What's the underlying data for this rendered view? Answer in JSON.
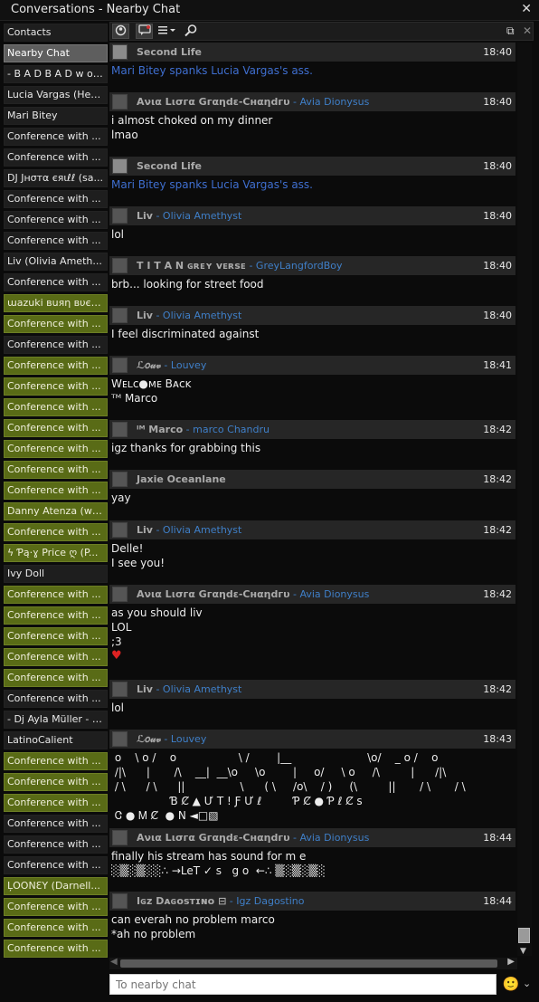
{
  "window": {
    "title": "Conversations - Nearby Chat",
    "close_glyph": "✕"
  },
  "sidebar": {
    "items": [
      {
        "label": "Contacts",
        "state": "plain"
      },
      {
        "label": "Nearby Chat",
        "state": "active"
      },
      {
        "label": "- B A D  B A D  w o l...",
        "state": "plain"
      },
      {
        "label": "Lucia Vargas (Her...",
        "state": "plain"
      },
      {
        "label": "Mari Bitey",
        "state": "plain"
      },
      {
        "label": "Conference with ...",
        "state": "plain"
      },
      {
        "label": "Conference with ...",
        "state": "plain"
      },
      {
        "label": "DJ Jнσтα єяιℓℓ (sa...",
        "state": "plain"
      },
      {
        "label": "Conference with ...",
        "state": "plain"
      },
      {
        "label": "Conference with ...",
        "state": "plain"
      },
      {
        "label": "Conference with ...",
        "state": "plain"
      },
      {
        "label": "Liv (Olivia Ameth...",
        "state": "plain"
      },
      {
        "label": "Conference with ...",
        "state": "plain"
      },
      {
        "label": "ɯazuki вuяη вυєη...",
        "state": "flash"
      },
      {
        "label": "Conference with ...",
        "state": "flash"
      },
      {
        "label": "Conference with ...",
        "state": "plain"
      },
      {
        "label": "Conference with ...",
        "state": "flash"
      },
      {
        "label": "Conference with ...",
        "state": "flash"
      },
      {
        "label": "Conference with ...",
        "state": "flash"
      },
      {
        "label": "Conference with ...",
        "state": "flash"
      },
      {
        "label": "Conference with ...",
        "state": "flash"
      },
      {
        "label": "Conference with ...",
        "state": "flash"
      },
      {
        "label": "Conference with ...",
        "state": "flash"
      },
      {
        "label": "Danny Atenza (wa...",
        "state": "flash"
      },
      {
        "label": "Conference with ...",
        "state": "flash"
      },
      {
        "label": "ϟ Ƥą·ɣ Price ღ (P...",
        "state": "flash"
      },
      {
        "label": "Ivy Doll",
        "state": "plain"
      },
      {
        "label": "Conference with ...",
        "state": "flash"
      },
      {
        "label": "Conference with ...",
        "state": "flash"
      },
      {
        "label": "Conference with ...",
        "state": "flash"
      },
      {
        "label": "Conference with ...",
        "state": "flash"
      },
      {
        "label": "Conference with ...",
        "state": "flash"
      },
      {
        "label": "Conference with ...",
        "state": "plain"
      },
      {
        "label": "- Dj Ayla Müller - (...",
        "state": "plain"
      },
      {
        "label": "LatinoCalient",
        "state": "plain"
      },
      {
        "label": "Conference with ...",
        "state": "flash"
      },
      {
        "label": "Conference with ...",
        "state": "flash"
      },
      {
        "label": "Conference with ...",
        "state": "flash"
      },
      {
        "label": "Conference with ...",
        "state": "plain"
      },
      {
        "label": "Conference with ...",
        "state": "plain"
      },
      {
        "label": "Conference with ...",
        "state": "plain"
      },
      {
        "label": "ĻOONƐΥ (Darnell...",
        "state": "flash"
      },
      {
        "label": "Conference with ...",
        "state": "flash"
      },
      {
        "label": "Conference with ...",
        "state": "flash"
      },
      {
        "label": "Conference with ...",
        "state": "flash"
      }
    ]
  },
  "toolbar": {
    "icons": [
      "people-icon",
      "chat-bubble-icon",
      "list-menu-icon",
      "search-icon"
    ],
    "undock_glyph": "⧉",
    "close_glyph": "✕"
  },
  "messages": [
    {
      "avatar": "system",
      "display": "Second Life",
      "user": "",
      "time": "18:40",
      "system": true,
      "lines": [
        "Mari Bitey spanks Lucia Vargas's ass."
      ]
    },
    {
      "avatar": "user",
      "display": "Aνια Lισгα Gгαηdε-Cнαηdгυ",
      "user": "Avia Dionysus",
      "time": "18:40",
      "lines": [
        "i almost choked on my dinner",
        "lmao"
      ]
    },
    {
      "avatar": "system",
      "display": "Second Life",
      "user": "",
      "time": "18:40",
      "system": true,
      "lines": [
        "Mari Bitey spanks Lucia Vargas's ass."
      ]
    },
    {
      "avatar": "user",
      "display": "Liv",
      "user": "Olivia Amethyst",
      "time": "18:40",
      "lines": [
        "lol"
      ]
    },
    {
      "avatar": "user",
      "display": "T I T A N  ɢʀᴇʏ ᴠᴇʀsᴇ",
      "user": "GreyLangfordBoy",
      "time": "18:40",
      "lines": [
        "brb... looking for street food"
      ]
    },
    {
      "avatar": "user",
      "display": "Liv",
      "user": "Olivia Amethyst",
      "time": "18:40",
      "lines": [
        "I feel discriminated against"
      ]
    },
    {
      "avatar": "user",
      "display": "ℒ𝑜𝓊𝓋",
      "user": "Louvey",
      "time": "18:41",
      "lines": [
        "Wᴇʟᴄ●ᴍᴇ Bᴀᴄᴋ",
        "ᵀᴹ Marco"
      ]
    },
    {
      "avatar": "user",
      "display": "ᴵᴹ Marco",
      "user": "marco Chandru",
      "time": "18:42",
      "lines": [
        "igz thanks for grabbing this"
      ]
    },
    {
      "avatar": "user",
      "display": "Jaxie Oceanlane",
      "user": "",
      "time": "18:42",
      "lines": [
        "yay"
      ]
    },
    {
      "avatar": "user",
      "display": "Liv",
      "user": "Olivia Amethyst",
      "time": "18:42",
      "lines": [
        "Delle!",
        "I see you!"
      ]
    },
    {
      "avatar": "user",
      "display": "Aνια Lισгα Gгαηdε-Cнαηdгυ",
      "user": "Avia Dionysus",
      "time": "18:42",
      "lines": [
        "as you should liv",
        "LOL",
        ";3",
        "♥"
      ]
    },
    {
      "avatar": "user",
      "display": "Liv",
      "user": "Olivia Amethyst",
      "time": "18:42",
      "lines": [
        "lol"
      ]
    },
    {
      "avatar": "user",
      "display": "ℒ𝑜𝓊𝓋",
      "user": "Louvey",
      "time": "18:43",
      "lines": [
        " o    \\ o /    o                  \\ /        |__                      \\o/    _ o /    o",
        " /|\\      |       /\\    __|  __\\o     \\o        |     o/     \\ o     /\\         |      /|\\",
        " / \\      / \\      ||                \\      ( \\     /o\\    / )     (\\         ||       / \\       / \\",
        "                 Ɓ Ȼ ▲ Ư T ! Ƒ Ư ℓ         Ƥ Ȼ ● Ƥ ℓ Ȼ s",
        " Ꮳ ● Ꮇ Ȼ  ● Ν ◄□▧"
      ]
    },
    {
      "avatar": "user",
      "display": "Aνια Lισгα Gгαηdε-Cнαηdгυ",
      "user": "Avia Dionysus",
      "time": "18:44",
      "lines": [
        "finally his stream has sound for m e",
        "░▒░▒░░∴ →LeT ✓ s   g o  ←∴ ▒░▒░▒░"
      ]
    },
    {
      "avatar": "user",
      "display": "Iɢᴢ Dᴀɢᴏsᴛɪɴᴏ ⊟",
      "user": "Igz Dagostino",
      "time": "18:44",
      "lines": [
        "can everah no problem marco",
        "*ah no problem"
      ]
    }
  ],
  "input": {
    "placeholder": "To nearby chat"
  },
  "emoji": {
    "glyph": "🙂"
  }
}
